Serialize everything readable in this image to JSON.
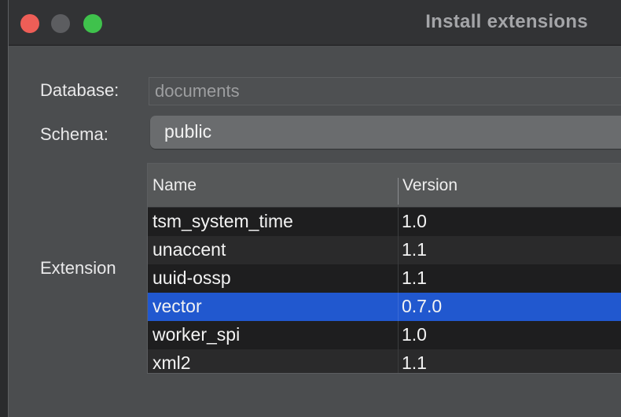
{
  "window": {
    "title": "Install extensions"
  },
  "form": {
    "database_label": "Database:",
    "database_value": "documents",
    "schema_label": "Schema:",
    "schema_value": "public",
    "extension_label": "Extension"
  },
  "table": {
    "columns": [
      "Name",
      "Version"
    ],
    "rows": [
      {
        "name": "tsm_system_time",
        "version": "1.0"
      },
      {
        "name": "unaccent",
        "version": "1.1"
      },
      {
        "name": "uuid-ossp",
        "version": "1.1"
      },
      {
        "name": "vector",
        "version": "0.7.0"
      },
      {
        "name": "worker_spi",
        "version": "1.0"
      },
      {
        "name": "xml2",
        "version": "1.1"
      }
    ],
    "selected_index": 3
  },
  "colors": {
    "selection": "#2158cf",
    "close": "#ee5e57",
    "zoom": "#3fc24c"
  }
}
